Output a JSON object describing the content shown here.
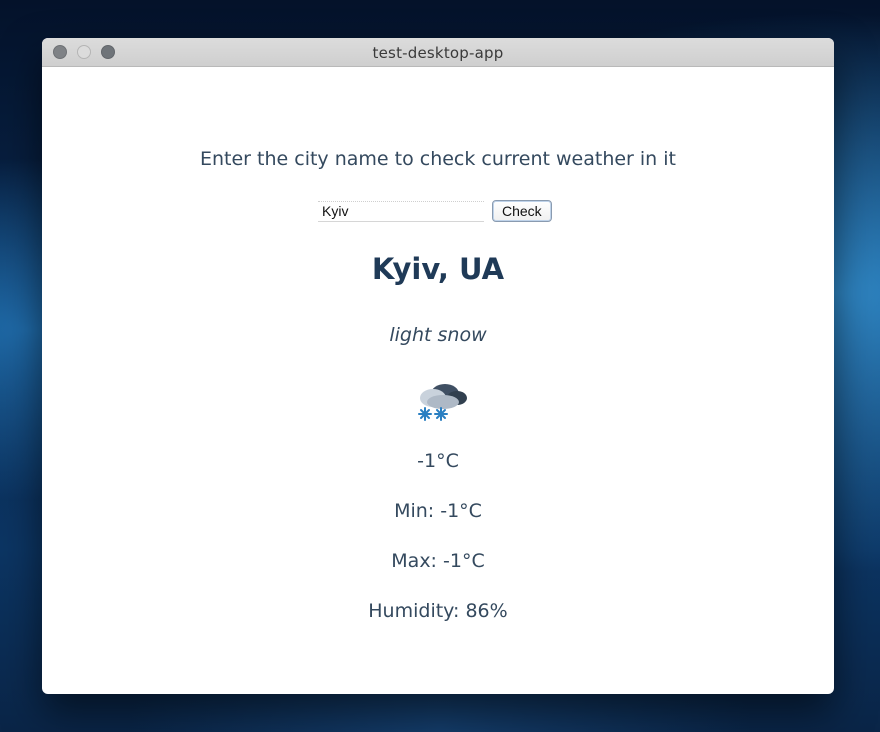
{
  "window": {
    "title": "test-desktop-app"
  },
  "form": {
    "prompt": "Enter the city name to check current weather in it",
    "city_value": "Kyiv",
    "check_label": "Check"
  },
  "weather": {
    "location": "Kyiv, UA",
    "description": "light snow",
    "icon": "light-snow-cloud-icon",
    "temperature": "-1°C",
    "min": "Min: -1°C",
    "max": "Max: -1°C",
    "humidity": "Humidity: 86%"
  }
}
